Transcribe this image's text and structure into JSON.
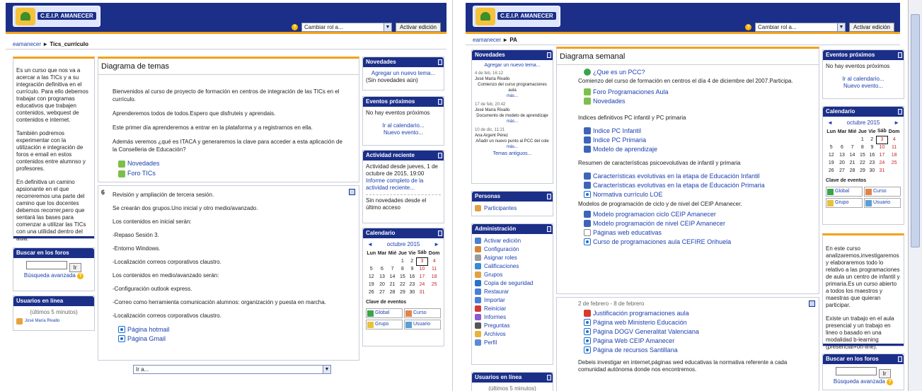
{
  "left": {
    "site_name": "C.E.I.P. AMANECER",
    "role_select": "Cambiar rol a...",
    "edit_button": "Activar edición",
    "breadcrumb": {
      "home": "eamanecer",
      "sep": "►",
      "current": "Tics_currículo"
    },
    "summary_paragraphs": [
      "Es un curso que nos va a acercar a las TICs y a su integración definitiva en el currículo. Para ello debemos trabajar con programas educativos que trabajen contenidos, webquest de contenidos e internet.",
      "También podremos experimentar con la utilización e integración de foros e email en estos contenidos entre alumnso y profesores.",
      "En definitiva un camino apsionante en el que recorreremos una parte del camino que los docentes debemos recorrer,pero que sentará las bases para comenzar a utilizar las TICs con una utilidad dentro del aula."
    ],
    "search_forums": {
      "title": "Buscar en los foros",
      "button": "Ir",
      "advanced": "Búsqueda avanzada"
    },
    "online_users": {
      "title": "Usuarios en línea",
      "note": "(últimos 5 minutos)",
      "user": "José María Rivallo"
    },
    "main_title": "Diagrama de temas",
    "intro": [
      "Bienvenidos al curso de proyecto de formación en centros de integración de las TICs en el currículo.",
      "Aprenderemos todos de todos.Espero que disfruteis y aprendais.",
      "Este primer día aprenderemos a entrar en la plataforma y a registrarnos en ella.",
      "Además veremos ¿qué es ITACA y generaremos la clave para acceder a esta aplicación de la Conselleria de Educación?"
    ],
    "intro_links": [
      "Novedades",
      "Foro TICs"
    ],
    "section_number": "6",
    "section_lines": [
      "Revisión y ampliación de tercera sesión.",
      "Se crearán dos grupos.Uno inicial y otro medio/avanzado.",
      "Los contenidos en inicial serán:",
      "-Repaso Sesión 3.",
      "-Entorno Windows.",
      "-Localización correos corporativos claustro.",
      "Los contenidos en medio/avanzado serán:",
      "-Configuración outlook express.",
      "-Correo como herramienta comunicación alumnos: organización y puesta en marcha.",
      "-Localización correos corporativos claustro."
    ],
    "section_links": [
      "Página hotmail",
      "Página Gmail"
    ],
    "jump_select": "Ir a...",
    "news": {
      "title": "Novedades",
      "add": "Agregar un nuevo tema...",
      "none": "(Sin novedades aún)"
    },
    "events": {
      "title": "Eventos próximos",
      "none": "No hay eventos próximos",
      "calendar": "Ir al calendario...",
      "new": "Nuevo evento..."
    },
    "activity": {
      "title": "Actividad reciente",
      "since": "Actividad desde jueves, 1 de octubre de 2015, 19:00",
      "report": "Informe completo de la actividad reciente...",
      "none": "Sin novedades desde el último acceso"
    },
    "calendar": {
      "title": "Calendario",
      "month": "octubre 2015",
      "prev": "◄",
      "next": "►",
      "days": [
        "Lun",
        "Mar",
        "Mié",
        "Jue",
        "Vie",
        "Sáb",
        "Dom"
      ],
      "weeks": [
        [
          "",
          "",
          "",
          "1",
          "2",
          "3",
          "4"
        ],
        [
          "5",
          "6",
          "7",
          "8",
          "9",
          "10",
          "11"
        ],
        [
          "12",
          "13",
          "14",
          "15",
          "16",
          "17",
          "18"
        ],
        [
          "19",
          "20",
          "21",
          "22",
          "23",
          "24",
          "25"
        ],
        [
          "26",
          "27",
          "28",
          "29",
          "30",
          "31",
          ""
        ]
      ],
      "key_title": "Clave de eventos",
      "keys": [
        "Global",
        "Curso",
        "Grupo",
        "Usuario"
      ]
    }
  },
  "right": {
    "site_name": "C.E.I.P. AMANECER",
    "role_select": "Cambiar rol a...",
    "edit_button": "Activar edición",
    "breadcrumb": {
      "home": "eamanecer",
      "sep": "►",
      "current": "PA"
    },
    "news": {
      "title": "Novedades",
      "add": "Agregar un nuevo tema...",
      "posts": [
        {
          "date": "4 de feb, 16:12",
          "author": "José María Rivallo",
          "text": "Comienzo del curso programaciones aula",
          "more": "más..."
        },
        {
          "date": "17 de feb, 20:42",
          "author": "José María Rivallo",
          "text": "Documento de modelo de aprendizaje",
          "more": "más..."
        },
        {
          "date": "10 de dic, 11:21",
          "author": "Ana Argent Pérez",
          "text": "Añadir un nuevo punto al PCC del cole",
          "more": "más..."
        }
      ],
      "older": "Temas antiguos..."
    },
    "people": {
      "title": "Personas",
      "participants": "Participantes"
    },
    "admin": {
      "title": "Administración",
      "items": [
        "Activar edición",
        "Configuración",
        "Asignar roles",
        "Calificaciones",
        "Grupos",
        "Copia de seguridad",
        "Restaurar",
        "Importar",
        "Reiniciar",
        "Informes",
        "Preguntas",
        "Archivos",
        "Perfil"
      ]
    },
    "online_users": {
      "title": "Usuarios en línea",
      "note": "(últimos 5 minutos)"
    },
    "main_title": "Diagrama semanal",
    "top_section": {
      "link1": "¿Que es un PCC?",
      "text1": "Comienzo del curso de formación en centros el día 4 de diciembre del 2007.Participa.",
      "links_a": [
        "Foro Programaciones Aula",
        "Novedades"
      ],
      "text2": "Indices definitivos PC infantil y PC primaria",
      "links_b": [
        "Indice PC Infantil",
        "Indice PC Primaria",
        "Modelo de aprendizaje"
      ],
      "text3": "Resumen de características psicoevolutivas de infantil y primaria",
      "links_c": [
        "Características evolutivas en la etapa de Educación Infantil",
        "Características evolutivas en la etapa de Educación Primaria",
        "Normativa currículo LOE"
      ],
      "text4": "Modelos de programación de ciclo y de nivel del CEIP Amanecer.",
      "links_d": [
        "Modelo programacion ciclo CEIP Amanecer",
        "Modelo programación de nivel CEIP Amanecer",
        "Páginas web educativas",
        "Curso de programaciones aula CEFIRE Orihuela"
      ]
    },
    "week_section": {
      "dates": "2 de febrero - 8 de febrero",
      "links": [
        "Justificación programaciones aula",
        "Página web Ministerio Educación",
        "Página DOGV Generalitat Valenciana",
        "Página Web CEIP Amanecer",
        "Página de recursos Santillana"
      ],
      "text": "Debeis investigar en internet,páginas wed educativas la normativa referente a cada comunidad autónoma donde nos encontremos."
    },
    "events": {
      "title": "Eventos próximos",
      "none": "No hay eventos próximos",
      "calendar": "Ir al calendario...",
      "new": "Nuevo evento..."
    },
    "calendar": {
      "title": "Calendario",
      "month": "octubre 2015",
      "prev": "◄",
      "next": "►",
      "days": [
        "Lun",
        "Mar",
        "Mié",
        "Jue",
        "Vie",
        "Sáb",
        "Dom"
      ],
      "weeks": [
        [
          "",
          "",
          "",
          "1",
          "2",
          "3",
          "4"
        ],
        [
          "5",
          "6",
          "7",
          "8",
          "9",
          "10",
          "11"
        ],
        [
          "12",
          "13",
          "14",
          "15",
          "16",
          "17",
          "18"
        ],
        [
          "19",
          "20",
          "21",
          "22",
          "23",
          "24",
          "25"
        ],
        [
          "26",
          "27",
          "28",
          "29",
          "30",
          "31",
          ""
        ]
      ],
      "key_title": "Clave de eventos",
      "keys": [
        "Global",
        "Curso",
        "Grupo",
        "Usuario"
      ]
    },
    "summary_paragraphs": [
      "En este curso analizaremos,investigaremos y elaboraremos todo lo relativo a las programaciones de aula un centro de infantil y primaria.Es un curso abierto a todos los maestros y maestras que quieran participar.",
      "Existe un trabajo en el aula presencial y un trabajo en lineo o basado en una modalidad b-learning (presencial+on-line)."
    ],
    "search_forums": {
      "title": "Buscar en los foros",
      "button": "Ir",
      "advanced": "Búsqueda avanzada"
    }
  }
}
